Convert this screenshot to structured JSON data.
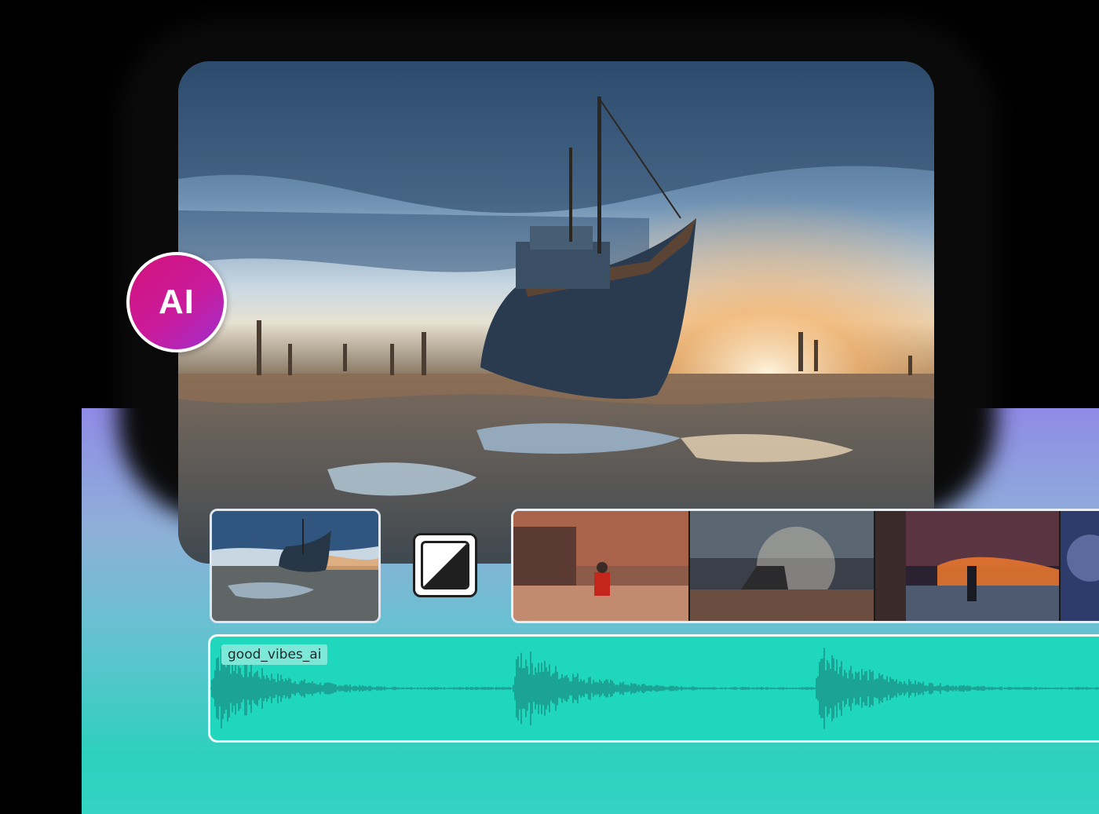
{
  "badge": {
    "label": "AI"
  },
  "audio": {
    "track_name": "good_vibes_ai"
  },
  "colors": {
    "accent_pink": "#d3127a",
    "accent_purple": "#9f2fd0",
    "audio_track": "#1fd7bd",
    "waveform": "#1a8f86"
  }
}
